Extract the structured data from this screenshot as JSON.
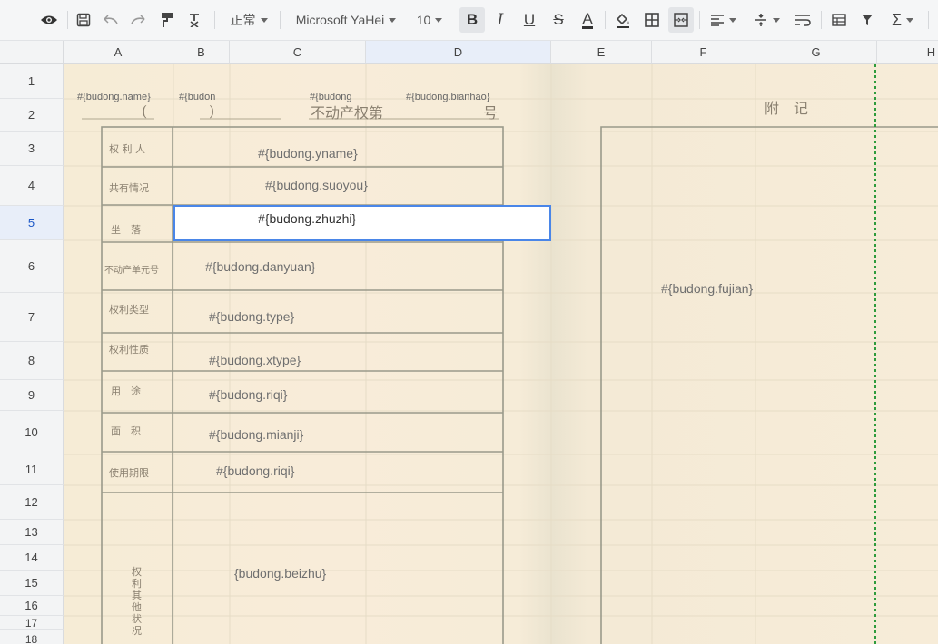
{
  "toolbar": {
    "number_format": "正常",
    "font_name": "Microsoft YaHei",
    "font_size": "10"
  },
  "columns": [
    "A",
    "B",
    "C",
    "D",
    "E",
    "F",
    "G",
    "H"
  ],
  "rows": [
    "1",
    "2",
    "3",
    "4",
    "5",
    "6",
    "7",
    "8",
    "9",
    "10",
    "11",
    "12",
    "13",
    "14",
    "15",
    "16",
    "17",
    "18"
  ],
  "selected": {
    "column": "D",
    "row": "5"
  },
  "cells": {
    "a1_name": "#{budong.name}",
    "b1_frag": "#{budon",
    "c1_frag": "#{budong",
    "d1_bianhao": "#{budong.bianhao}",
    "c3_yname": "#{budong.yname}",
    "c4_suoyou": "#{budong.suoyou}",
    "c5_zhuzhi": "#{budong.zhuzhi}",
    "c6_danyuan": "#{budong.danyuan}",
    "c7_type": "#{budong.type}",
    "c8_xtype": "#{budong.xtype}",
    "c9_riqi": "#{budong.riqi}",
    "c10_mianji": "#{budong.mianji}",
    "c11_riqi": "#{budong.riqi}",
    "c15_beizhu": "{budong.beizhu}",
    "f6_fujian": "#{budong.fujian}"
  },
  "background_text": {
    "paren_open": "(",
    "paren_close": ")",
    "title": "不动产权第",
    "hao": "号",
    "fuji": "附　记",
    "quanliren": "权 利 人",
    "gongyou": "共有情况",
    "zuoluo": "坐　落",
    "danyuanhao": "不动产单元号",
    "leixing": "权利类型",
    "xingzhi": "权利性质",
    "yongtu": "用　途",
    "mianji": "面　积",
    "qixian": "使用期限",
    "qita": "权利其他状况"
  },
  "colors": {
    "accent": "#4a86e8",
    "paper": "#f6ecd6",
    "guide": "#2e9b3c"
  }
}
